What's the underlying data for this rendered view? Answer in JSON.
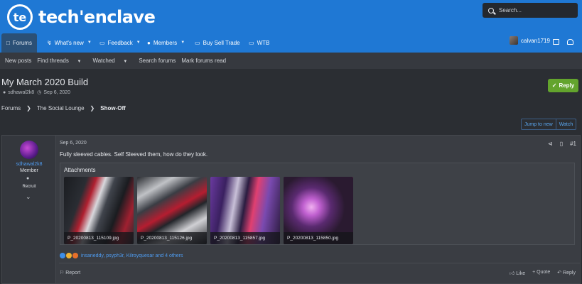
{
  "header": {
    "logo_badge": "te",
    "logo_text": "tech'enclave",
    "search_placeholder": "Search..."
  },
  "nav": {
    "tabs": [
      {
        "label": "Forums",
        "icon": "forums-icon"
      },
      {
        "label": "What's new",
        "icon": "lightning-icon"
      },
      {
        "label": "Feedback",
        "icon": "folder-icon"
      },
      {
        "label": "Members",
        "icon": "members-icon"
      },
      {
        "label": "Buy Sell Trade",
        "icon": "folder-icon"
      },
      {
        "label": "WTB",
        "icon": "folder-icon"
      }
    ],
    "username": "calvan1719"
  },
  "subnav": {
    "items": [
      "New posts",
      "Find threads",
      "Watched",
      "Search forums",
      "Mark forums read"
    ]
  },
  "thread": {
    "title": "My March 2020 Build",
    "author": "sdhawal2k8",
    "date": "Sep 6, 2020",
    "reply_label": "Reply"
  },
  "breadcrumb": {
    "items": [
      "Forums",
      "The Social Lounge",
      "Show-Off"
    ]
  },
  "jump": {
    "new_label": "Jump to new",
    "watch_label": "Watch"
  },
  "post": {
    "user": {
      "name": "sdhawal2k8",
      "role": "Member",
      "badge": "Recruit"
    },
    "date": "Sep 6, 2020",
    "number": "#1",
    "body": "Fully sleeved cables. Self Sleeved them, how do they look.",
    "attachments_title": "Attachments",
    "attachments": [
      {
        "name": "P_20200813_115109.jpg"
      },
      {
        "name": "P_20200813_115126.jpg"
      },
      {
        "name": "P_20200813_115857.jpg"
      },
      {
        "name": "P_20200813_115850.jpg"
      }
    ],
    "reactions_text": "insaneddy, psyph3r, Kilroyquesar and 4 others",
    "report_label": "Report",
    "like_label": "Like",
    "quote_label": "+ Quote",
    "reply_label": "Reply"
  },
  "colors": {
    "header_blue": "#1f78d4",
    "reply_green": "#63a42d",
    "link_blue": "#4f9cf0",
    "background": "#2b2e33"
  }
}
